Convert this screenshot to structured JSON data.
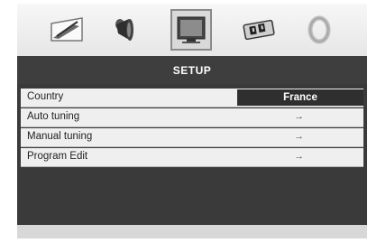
{
  "tabs": [
    {
      "icon": "picture-icon",
      "active": false
    },
    {
      "icon": "sound-icon",
      "active": false
    },
    {
      "icon": "setup-tv-icon",
      "active": true
    },
    {
      "icon": "options-icon",
      "active": false
    },
    {
      "icon": "lock-icon",
      "active": false
    }
  ],
  "header": {
    "title": "SETUP"
  },
  "menu": {
    "items": [
      {
        "label": "Country",
        "value": "France"
      },
      {
        "label": "Auto tuning",
        "value": "→"
      },
      {
        "label": "Manual tuning",
        "value": "→"
      },
      {
        "label": "Program Edit",
        "value": "→"
      }
    ]
  }
}
